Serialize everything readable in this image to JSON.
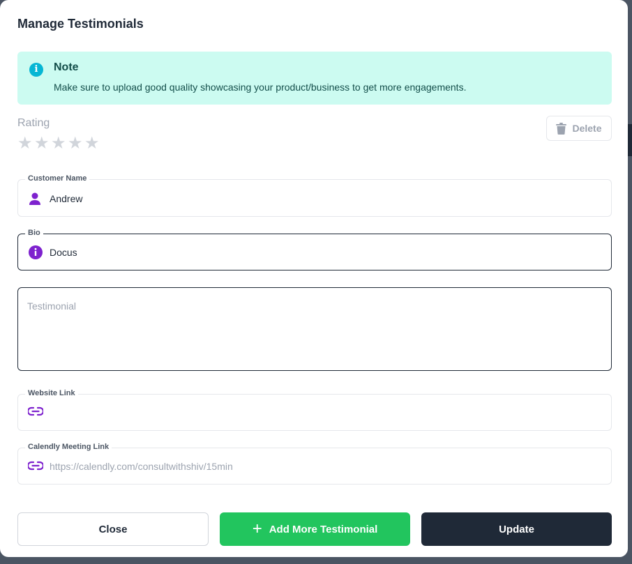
{
  "modal": {
    "title": "Manage Testimonials"
  },
  "note": {
    "icon": "info-icon",
    "title": "Note",
    "text": "Make sure to upload good quality showcasing your product/business to get more engagements."
  },
  "rating": {
    "label": "Rating",
    "value": 0,
    "max": 5
  },
  "delete": {
    "label": "Delete",
    "icon": "trash-icon"
  },
  "fields": {
    "customer_name": {
      "label": "Customer Name",
      "value": "Andrew",
      "icon": "user-icon"
    },
    "bio": {
      "label": "Bio",
      "value": "Docus",
      "icon": "info-circle-icon"
    },
    "testimonial": {
      "placeholder": "Testimonial",
      "value": ""
    },
    "website_link": {
      "label": "Website Link",
      "value": "",
      "icon": "link-icon"
    },
    "calendly_link": {
      "label": "Calendly Meeting Link",
      "placeholder": "https://calendly.com/consultwithshiv/15min",
      "value": "",
      "icon": "link-icon"
    }
  },
  "actions": {
    "close_label": "Close",
    "add_label": "Add More Testimonial",
    "update_label": "Update"
  },
  "colors": {
    "accent": "#7e22ce",
    "note_bg": "#ccfbf1",
    "success": "#22c55e",
    "dark": "#1f2937"
  }
}
